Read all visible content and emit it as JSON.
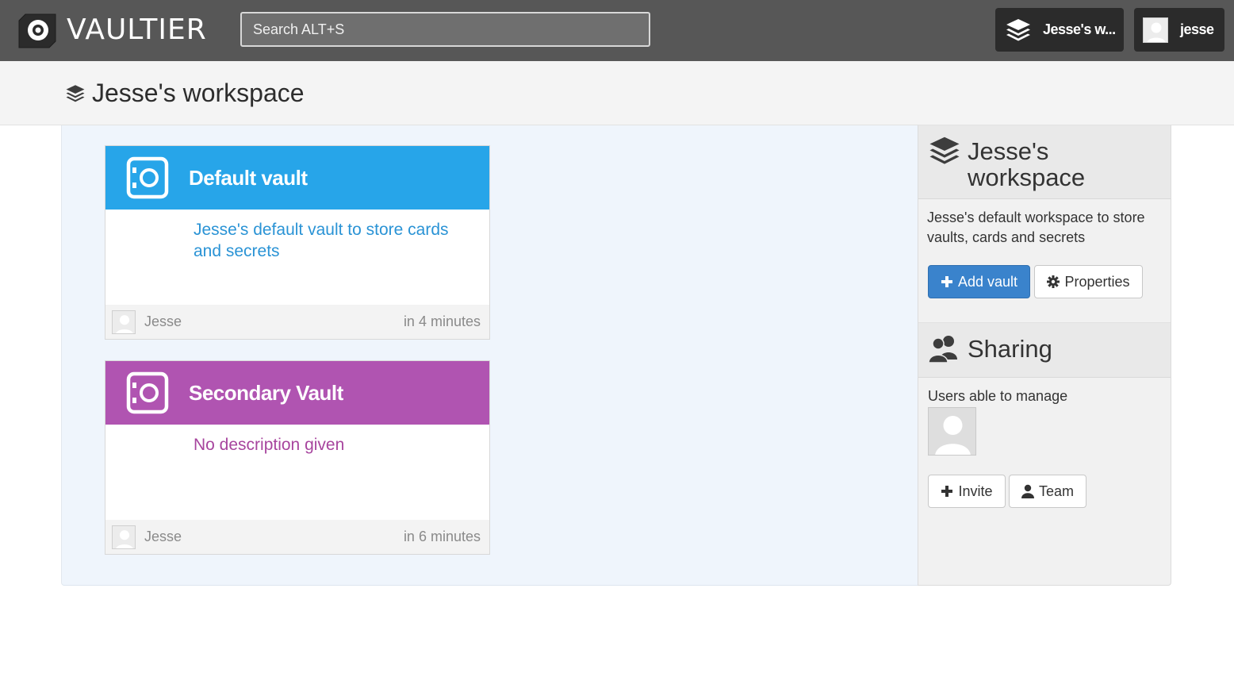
{
  "topbar": {
    "brand": "VAULTIER",
    "search_placeholder": "Search ALT+S",
    "workspace_button": "Jesse's w...",
    "user_button": "jesse",
    "icons": {
      "logo": "vault-logo-icon",
      "workspace": "stack-icon",
      "user": "avatar-icon"
    }
  },
  "page": {
    "title": "Jesse's workspace"
  },
  "vaults": [
    {
      "name": "Default vault",
      "description": "Jesse's default vault to store cards and secrets",
      "owner": "Jesse",
      "time": "in 4 minutes",
      "color": "#27a5e9",
      "desc_color": "#2a93d5"
    },
    {
      "name": "Secondary Vault",
      "description": "No description given",
      "owner": "Jesse",
      "time": "in 6 minutes",
      "color": "#b054b1",
      "desc_color": "#a7459e"
    }
  ],
  "sidebar": {
    "workspace_title_line1": "Jesse's",
    "workspace_title_line2": "workspace",
    "workspace_description": "Jesse's default workspace to store vaults, cards and secrets",
    "add_vault_label": "Add vault",
    "properties_label": "Properties",
    "sharing_title": "Sharing",
    "users_label": "Users able to manage",
    "invite_label": "Invite",
    "team_label": "Team"
  },
  "colors": {
    "topbar_bg": "#575757",
    "button_dark": "#2b2b2b",
    "primary": "#3a83cc",
    "main_bg": "#eff5fc"
  }
}
